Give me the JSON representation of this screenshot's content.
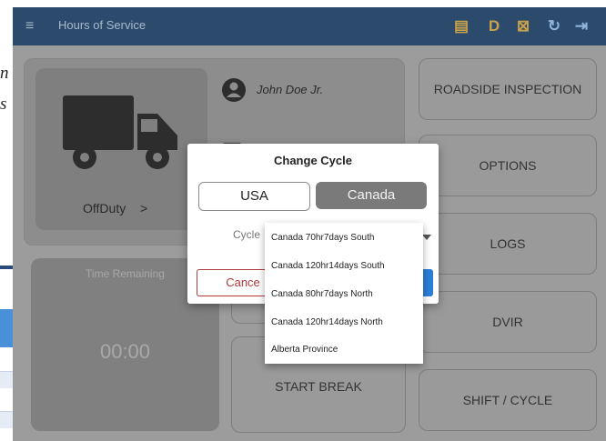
{
  "doc": {
    "line1": "n",
    "line2": "s"
  },
  "appbar": {
    "title": "Hours of Service",
    "menu_icon": "≡",
    "icons": [
      {
        "name": "messages-icon",
        "glyph": "▤"
      },
      {
        "name": "driver-status-icon",
        "glyph": "D"
      },
      {
        "name": "sync-icon",
        "glyph": "⊠"
      },
      {
        "name": "refresh-icon",
        "glyph": "↻"
      },
      {
        "name": "logout-icon",
        "glyph": "⇥"
      }
    ]
  },
  "driver": {
    "name": "John Doe Jr.",
    "status": "OffDuty",
    "status_chevron": ">"
  },
  "time_remaining": {
    "label": "Time Remaining",
    "value": "00:00"
  },
  "start_break": "START BREAK",
  "right_buttons": {
    "roadside": "ROADSIDE INSPECTION",
    "options": "OPTIONS",
    "logs": "LOGS",
    "dvir": "DVIR",
    "shift_cycle": "SHIFT / CYCLE"
  },
  "dialog": {
    "title": "Change Cycle",
    "usa": "USA",
    "canada": "Canada",
    "cycle_label": "Cycle",
    "cancel": "Cance",
    "selected_country": "Canada"
  },
  "cycle_options": [
    "Canada 70hr7days South",
    "Canada 120hr14days South",
    "Canada 80hr7days North",
    "Canada 120hr14days North",
    "Alberta Province"
  ],
  "colors": {
    "appbar": "#2c4b6c",
    "overlay": "#9c9c9c",
    "selected_segment": "#7a7a7a",
    "cancel": "#b23b3b",
    "ok": "#2b7fd8"
  }
}
